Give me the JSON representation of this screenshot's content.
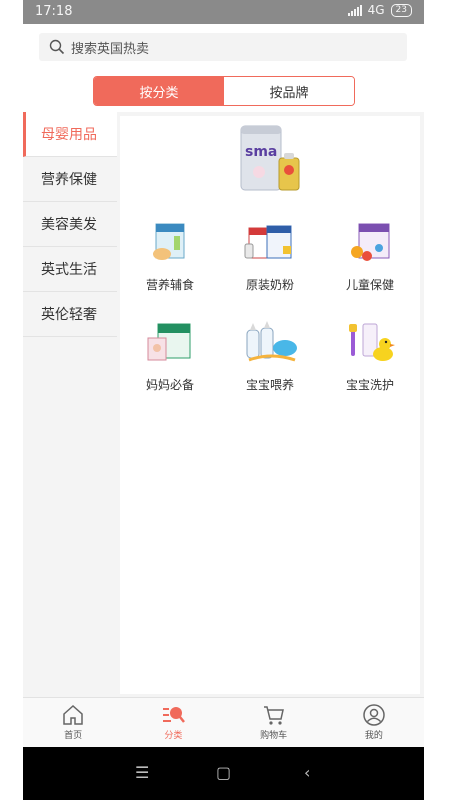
{
  "status_bar": {
    "time": "17:18",
    "network": "4G",
    "battery": "23"
  },
  "search": {
    "placeholder": "搜索英国热卖"
  },
  "tabs": [
    {
      "label": "按分类",
      "active": true
    },
    {
      "label": "按品牌",
      "active": false
    }
  ],
  "sidebar": {
    "items": [
      {
        "label": "母婴用品",
        "active": true
      },
      {
        "label": "营养保健",
        "active": false
      },
      {
        "label": "美容美发",
        "active": false
      },
      {
        "label": "英式生活",
        "active": false
      },
      {
        "label": "英伦轻奢",
        "active": false
      }
    ]
  },
  "content": {
    "banner_icon": "sma-formula-tin-image",
    "categories": [
      {
        "label": "营养辅食",
        "icon": "baby-food-box-icon"
      },
      {
        "label": "原装奶粉",
        "icon": "milk-powder-boxes-icon"
      },
      {
        "label": "儿童保健",
        "icon": "kids-vitamins-icon"
      },
      {
        "label": "妈妈必备",
        "icon": "mom-essentials-box-icon"
      },
      {
        "label": "宝宝喂养",
        "icon": "baby-bottles-icon"
      },
      {
        "label": "宝宝洗护",
        "icon": "bath-duck-toothbrush-icon"
      }
    ]
  },
  "bottom_nav": [
    {
      "label": "首页",
      "icon": "home-icon",
      "active": false
    },
    {
      "label": "分类",
      "icon": "category-icon",
      "active": true
    },
    {
      "label": "购物车",
      "icon": "cart-icon",
      "active": false
    },
    {
      "label": "我的",
      "icon": "user-icon",
      "active": false
    }
  ],
  "system_nav": {
    "menu": "☰",
    "home": "▢",
    "back": "‹"
  },
  "colors": {
    "accent": "#f06a5b",
    "status_bar": "#8a8a8a",
    "background": "#f4f4f4"
  }
}
